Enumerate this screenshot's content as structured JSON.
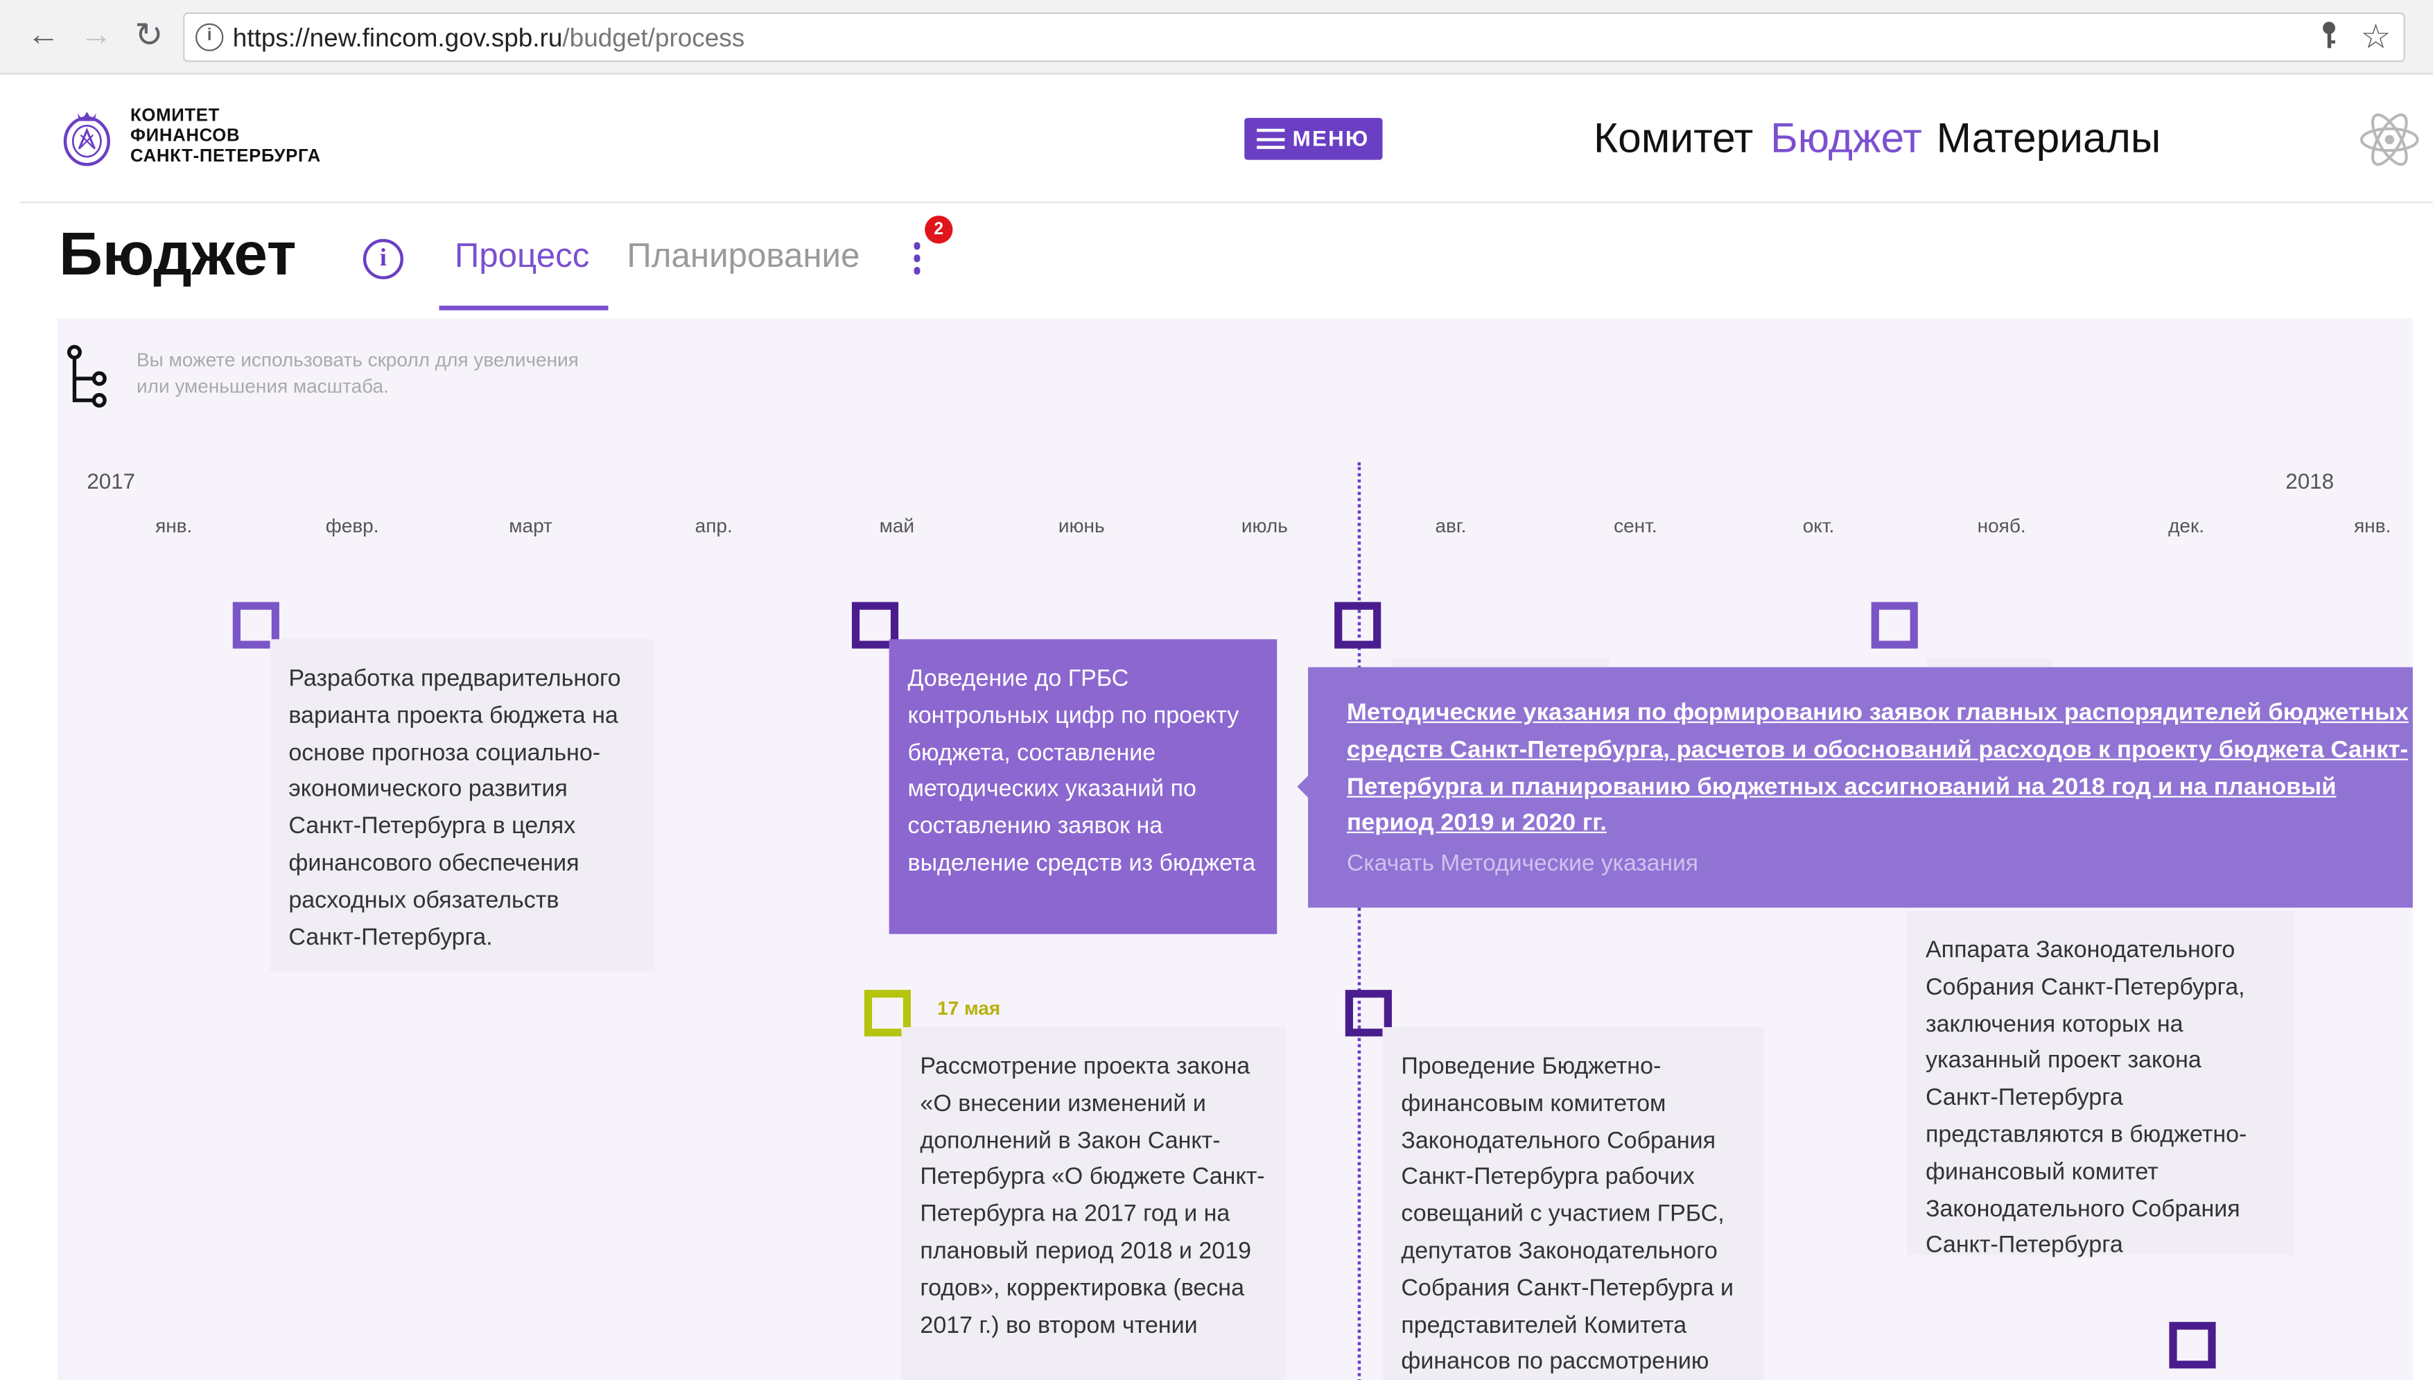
{
  "browser": {
    "url_host": "https://new.fincom.gov.spb.ru",
    "url_path": "/budget/process",
    "back_icon": "←",
    "forward_icon": "→",
    "reload_icon": "↻"
  },
  "header": {
    "logo_lines": [
      "КОМИТЕТ",
      "ФИНАНСОВ",
      "САНКТ-ПЕТЕРБУРГА"
    ],
    "menu_label": "МЕНЮ",
    "nav": [
      "Комитет",
      "Бюджет",
      "Материалы"
    ],
    "accent": "#7b4fd0"
  },
  "page": {
    "title": "Бюджет",
    "info_symbol": "i",
    "tabs": [
      "Процесс",
      "Планирование"
    ],
    "more_badge": "2"
  },
  "timeline": {
    "hint_line1": "Вы можете использовать скролл для увеличения",
    "hint_line2": "или уменьшения масштаба.",
    "year_start": "2017",
    "year_end": "2018",
    "months": [
      "янв.",
      "февр.",
      "март",
      "апр.",
      "май",
      "июнь",
      "июль",
      "авг.",
      "сент.",
      "окт.",
      "нояб.",
      "дек.",
      "янв."
    ],
    "cards": [
      "Разработка предварительного варианта проекта бюджета на основе прогноза социально-экономического развития Санкт-Петербурга в целях финансового обеспечения расходных обязательств Санкт-Петербурга.",
      "Доведение до ГРБС контрольных цифр по проекту бюджета, составление методических указаний по составлению заявок на выделение средств из бюджета",
      "Рассмотрение проекта закона «О внесении изменений и дополнений в Закон Санкт-Петербурга  «О бюджете Санкт-Петербурга на 2017 год и на плановый период 2018 и 2019 годов», корректировка (весна 2017 г.) во втором чтении",
      "Проведение Бюджетно-финансовым комитетом Законодательного Собрания Санкт-Петербурга рабочих совещаний с участием ГРБС, депутатов Законодательного Собрания Санкт-Петербурга и представителей Комитета финансов по рассмотрению",
      "Аппарата Законодательного Собрания Санкт-Петербурга, заключения которых на указанный проект закона Санкт-Петербурга представляются в бюджетно-финансовый комитет Законодательного Собрания Санкт-Петербурга"
    ],
    "date_label": "17 мая",
    "popup_link": "Методические указания по формированию заявок главных распорядителей бюджетных средств Санкт-Петербурга, расчетов и обоснований расходов к проекту бюджета Санкт-Петербурга и планированию бюджетных ассигнований на 2018 год и на плановый период 2019 и 2020 гг.",
    "popup_download": "Скачать Методические указания"
  }
}
